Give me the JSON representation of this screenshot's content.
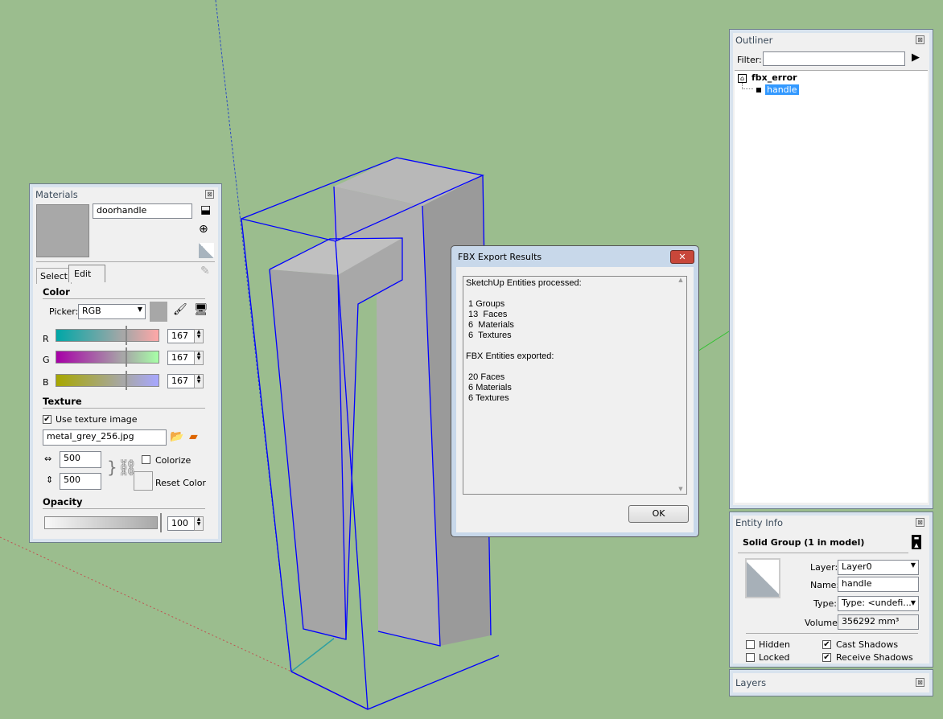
{
  "materials": {
    "title": "Materials",
    "name_value": "doorhandle",
    "tabs": [
      "Select",
      "Edit"
    ],
    "color_heading": "Color",
    "picker_label": "Picker:",
    "picker_value": "RGB",
    "channels": [
      {
        "label": "R",
        "value": "167"
      },
      {
        "label": "G",
        "value": "167"
      },
      {
        "label": "B",
        "value": "167"
      }
    ],
    "texture_heading": "Texture",
    "use_texture_label": "Use texture image",
    "use_texture_checked": true,
    "texture_file": "metal_grey_256.jpg",
    "width_value": "500",
    "height_value": "500",
    "colorize_label": "Colorize",
    "colorize_checked": false,
    "reset_color_label": "Reset Color",
    "opacity_heading": "Opacity",
    "opacity_value": "100"
  },
  "outliner": {
    "title": "Outliner",
    "filter_label": "Filter:",
    "filter_value": "",
    "root": "fbx_error",
    "child": "handle"
  },
  "entity_info": {
    "title": "Entity Info",
    "header": "Solid Group (1 in model)",
    "layer_label": "Layer:",
    "layer_value": "Layer0",
    "name_label": "Name:",
    "name_value": "handle",
    "type_label": "Type:",
    "type_value": "Type: <undefi...",
    "volume_label": "Volume:",
    "volume_value": "356292 mm³",
    "hidden_label": "Hidden",
    "hidden_checked": false,
    "locked_label": "Locked",
    "locked_checked": false,
    "cast_label": "Cast Shadows",
    "cast_checked": true,
    "receive_label": "Receive Shadows",
    "receive_checked": true
  },
  "layers": {
    "title": "Layers"
  },
  "dialog": {
    "title": "FBX Export Results",
    "lines": [
      "SketchUp Entities processed:",
      "",
      " 1 Groups",
      " 13  Faces",
      " 6  Materials",
      " 6  Textures",
      "",
      "FBX Entities exported:",
      "",
      " 20 Faces",
      " 6 Materials",
      " 6 Textures"
    ],
    "ok_label": "OK"
  },
  "colors": {
    "background": "#9bbd8e",
    "selection": "#0000ff",
    "highlight": "#3399ff"
  }
}
